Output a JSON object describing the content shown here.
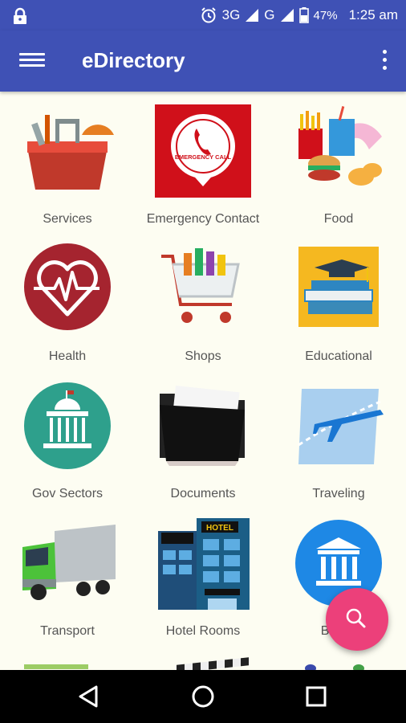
{
  "status_bar": {
    "network": "3G",
    "network2": "G",
    "battery": "47%",
    "time": "1:25 am"
  },
  "app_bar": {
    "title": "eDirectory"
  },
  "categories": [
    {
      "label": "Services",
      "icon": "toolbox-icon"
    },
    {
      "label": "Emergency Contact",
      "icon": "emergency-call-icon",
      "icon_text": "EMERGENCY CALL"
    },
    {
      "label": "Food",
      "icon": "fast-food-icon"
    },
    {
      "label": "Health",
      "icon": "heart-pulse-icon"
    },
    {
      "label": "Shops",
      "icon": "shopping-cart-icon"
    },
    {
      "label": "Educational",
      "icon": "books-graduation-icon"
    },
    {
      "label": "Gov Sectors",
      "icon": "government-building-icon"
    },
    {
      "label": "Documents",
      "icon": "folder-icon"
    },
    {
      "label": "Traveling",
      "icon": "airplane-icon"
    },
    {
      "label": "Transport",
      "icon": "truck-icon"
    },
    {
      "label": "Hotel Rooms",
      "icon": "hotel-icon",
      "icon_text": "HOTEL"
    },
    {
      "label": "Banks",
      "icon": "bank-icon"
    }
  ],
  "fab": {
    "icon": "search-icon"
  },
  "nav_bar": {
    "back": "back-icon",
    "home": "home-icon",
    "recents": "recents-icon"
  },
  "colors": {
    "primary": "#3f51b5",
    "accent": "#ec407a",
    "background": "#fdfdf2"
  }
}
